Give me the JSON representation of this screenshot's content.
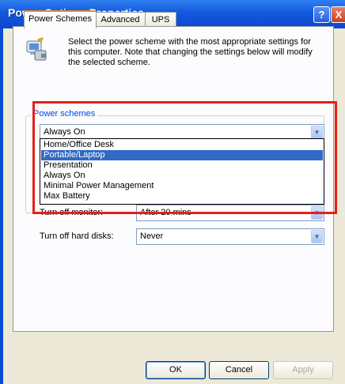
{
  "window": {
    "title": "Power Options Properties"
  },
  "titlebar": {
    "help_label": "?",
    "close_label": "X"
  },
  "tabs": [
    {
      "label": "Power Schemes",
      "active": true
    },
    {
      "label": "Advanced",
      "active": false
    },
    {
      "label": "UPS",
      "active": false
    }
  ],
  "description": "Select the power scheme with the most appropriate settings for this computer. Note that changing the settings below will modify the selected scheme.",
  "power_schemes": {
    "group_label": "Power schemes",
    "selected": "Always On",
    "options": [
      {
        "label": "Home/Office Desk",
        "highlighted": false
      },
      {
        "label": "Portable/Laptop",
        "highlighted": true
      },
      {
        "label": "Presentation",
        "highlighted": false
      },
      {
        "label": "Always On",
        "highlighted": false
      },
      {
        "label": "Minimal Power Management",
        "highlighted": false
      },
      {
        "label": "Max Battery",
        "highlighted": false
      }
    ]
  },
  "settings": {
    "monitor": {
      "label": "Turn off monitor:",
      "value": "After 20 mins"
    },
    "hard_disks": {
      "label": "Turn off hard disks:",
      "value": "Never"
    }
  },
  "buttons": {
    "ok": "OK",
    "cancel": "Cancel",
    "apply": "Apply"
  },
  "colors": {
    "titlebar": "#0b47cf",
    "selection": "#316ac5",
    "annotation": "#e3201b"
  }
}
